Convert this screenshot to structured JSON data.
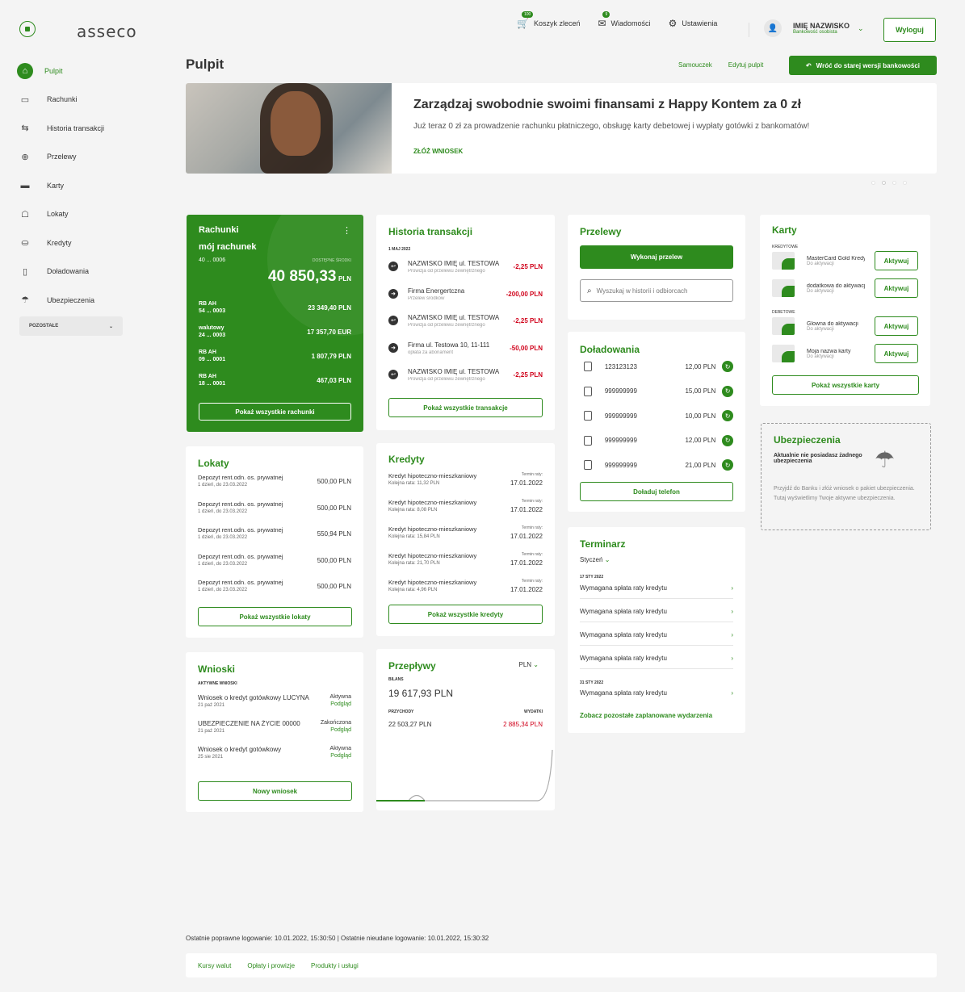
{
  "brand": "asseco",
  "top": {
    "cart": "Koszyk zleceń",
    "cart_badge": "100",
    "messages": "Wiadomości",
    "messages_badge": "9",
    "settings": "Ustawienia",
    "user_name": "IMIĘ NAZWISKO",
    "user_role": "Bankowość osobista",
    "logout": "Wyloguj"
  },
  "nav": [
    "Pulpit",
    "Rachunki",
    "Historia transakcji",
    "Przelewy",
    "Karty",
    "Lokaty",
    "Kredyty",
    "Doładowania",
    "Ubezpieczenia"
  ],
  "more": "POZOSTAŁE",
  "page": {
    "title": "Pulpit",
    "tutorial": "Samouczek",
    "edit": "Edytuj pulpit",
    "old": "Wróć do starej wersji bankowości"
  },
  "banner": {
    "title": "Zarządzaj swobodnie swoimi finansami z Happy Kontem za 0 zł",
    "text": "Już teraz 0 zł za prowadzenie rachunku płatniczego, obsługę karty debetowej i wypłaty gotówki z bankomatów!",
    "link": "ZŁÓŻ WNIOSEK"
  },
  "accounts": {
    "title": "Rachunki",
    "main_name": "mój rachunek",
    "main_no": "40 ... 0006",
    "avail": "DOSTĘPNE ŚRODKI",
    "main_amount": "40 850,33",
    "main_cur": "PLN",
    "list": [
      {
        "n1": "RB AH",
        "n2": "54 ... 0003",
        "a": "23 349,40 PLN"
      },
      {
        "n1": "walutowy",
        "n2": "24 ... 0003",
        "a": "17 357,70 EUR"
      },
      {
        "n1": "RB AH",
        "n2": "09 ... 0001",
        "a": "1 807,79 PLN"
      },
      {
        "n1": "RB AH",
        "n2": "18 ... 0001",
        "a": "467,03 PLN"
      }
    ],
    "btn": "Pokaż wszystkie rachunki"
  },
  "history": {
    "title": "Historia transakcji",
    "date": "1 MAJ 2022",
    "items": [
      {
        "n": "NAZWISKO IMIĘ ul. TESTOWA",
        "s": "Prowizja od przelewu zewnętrznego",
        "a": "-2,25 PLN"
      },
      {
        "n": "Firma Energertczna",
        "s": "Przelew środków",
        "a": "-200,00 PLN"
      },
      {
        "n": "NAZWISKO IMIĘ ul. TESTOWA",
        "s": "Prowizja od przelewu zewnętrznego",
        "a": "-2,25 PLN"
      },
      {
        "n": "Firma ul. Testowa 10, 11-111",
        "s": "opłata za abonament",
        "a": "-50,00 PLN"
      },
      {
        "n": "NAZWISKO IMIĘ ul. TESTOWA",
        "s": "Prowizja od przelewu zewnętrznego",
        "a": "-2,25 PLN"
      }
    ],
    "btn": "Pokaż wszystkie transakcje"
  },
  "transfers": {
    "title": "Przelewy",
    "btn": "Wykonaj przelew",
    "search": "Wyszukaj w historii i odbiorcach"
  },
  "topups": {
    "title": "Doładowania",
    "items": [
      {
        "n": "123123123",
        "a": "12,00 PLN"
      },
      {
        "n": "999999999",
        "a": "15,00 PLN"
      },
      {
        "n": "999999999",
        "a": "10,00 PLN"
      },
      {
        "n": "999999999",
        "a": "12,00 PLN"
      },
      {
        "n": "999999999",
        "a": "21,00 PLN"
      }
    ],
    "btn": "Doładuj telefon"
  },
  "cards": {
    "title": "Karty",
    "credit": "KREDYTOWE",
    "debit": "DEBETOWE",
    "items": [
      {
        "n": "MasterCard Gold Kredytowa",
        "s": "Do aktywacji"
      },
      {
        "n": "dodatkowa do aktywacji",
        "s": "Do aktywacji"
      },
      {
        "n": "Glowna do aktywacji",
        "s": "Do aktywacji"
      },
      {
        "n": "Moja nazwa karty",
        "s": "Do aktywacji"
      }
    ],
    "act": "Aktywuj",
    "btn": "Pokaż wszystkie karty"
  },
  "insurance": {
    "title": "Ubezpieczenia",
    "bold": "Aktualnie nie posiadasz żadnego ubezpieczenia",
    "text": "Przyjdź do Banku i złóż wniosek o pakiet ubezpieczenia. Tutaj wyświetlimy Twoje aktywne ubezpieczenia."
  },
  "deposits": {
    "title": "Lokaty",
    "items": [
      {
        "n": "Depozyt rent.odn. os. prywatnej",
        "s": "1 dzień, do 23.03.2022",
        "a": "500,00 PLN"
      },
      {
        "n": "Depozyt rent.odn. os. prywatnej",
        "s": "1 dzień, do 23.03.2022",
        "a": "500,00 PLN"
      },
      {
        "n": "Depozyt rent.odn. os. prywatnej",
        "s": "1 dzień, do 23.03.2022",
        "a": "550,94 PLN"
      },
      {
        "n": "Depozyt rent.odn. os. prywatnej",
        "s": "1 dzień, do 23.03.2022",
        "a": "500,00 PLN"
      },
      {
        "n": "Depozyt rent.odn. os. prywatnej",
        "s": "1 dzień, do 23.03.2022",
        "a": "500,00 PLN"
      }
    ],
    "btn": "Pokaż wszystkie lokaty"
  },
  "loans": {
    "title": "Kredyty",
    "term": "Termin raty:",
    "items": [
      {
        "n": "Kredyt hipoteczno-mieszkaniowy",
        "s": "Kolejna rata: 11,32 PLN",
        "d": "17.01.2022"
      },
      {
        "n": "Kredyt hipoteczno-mieszkaniowy",
        "s": "Kolejna rata: 8,08 PLN",
        "d": "17.01.2022"
      },
      {
        "n": "Kredyt hipoteczno-mieszkaniowy",
        "s": "Kolejna rata: 15,84 PLN",
        "d": "17.01.2022"
      },
      {
        "n": "Kredyt hipoteczno-mieszkaniowy",
        "s": "Kolejna rata: 21,70 PLN",
        "d": "17.01.2022"
      },
      {
        "n": "Kredyt hipoteczno-mieszkaniowy",
        "s": "Kolejna rata: 4,96 PLN",
        "d": "17.01.2022"
      }
    ],
    "btn": "Pokaż wszystkie kredyty"
  },
  "calendar": {
    "title": "Terminarz",
    "month": "Styczeń",
    "d1": "17 STY 2022",
    "d2": "31 STY 2022",
    "item": "Wymagana spłata raty kredytu",
    "link": "Zobacz pozostałe zaplanowane wydarzenia"
  },
  "apps": {
    "title": "Wnioski",
    "sub": "AKTYWNE WNIOSKI",
    "items": [
      {
        "n": "Wniosek o kredyt gotówkowy LUCYNA",
        "d": "21 paź 2021",
        "st": "Aktywna",
        "l": "Podgląd"
      },
      {
        "n": "UBEZPIECZENIE NA ŻYCIE 00000",
        "d": "21 paź 2021",
        "st": "Zakończona",
        "l": "Podgląd"
      },
      {
        "n": "Wniosek o kredyt gotówkowy",
        "d": "25 sie 2021",
        "st": "Aktywna",
        "l": "Podgląd"
      }
    ],
    "btn": "Nowy wniosek"
  },
  "flows": {
    "title": "Przepływy",
    "cur": "PLN",
    "bal_label": "BILANS",
    "bal": "19 617,93 PLN",
    "in_label": "PRZYCHODY",
    "in": "22 503,27 PLN",
    "out_label": "WYDATKI",
    "out": "2 885,34 PLN"
  },
  "footer": {
    "login": "Ostatnie poprawne logowanie: 10.01.2022, 15:30:50  |  Ostatnie nieudane logowanie: 10.01.2022, 15:30:32",
    "links": [
      "Kursy walut",
      "Opłaty i prowizje",
      "Produkty i usługi"
    ]
  },
  "colors": {
    "accent": "#2e8b1e",
    "negative": "#d0021b"
  }
}
